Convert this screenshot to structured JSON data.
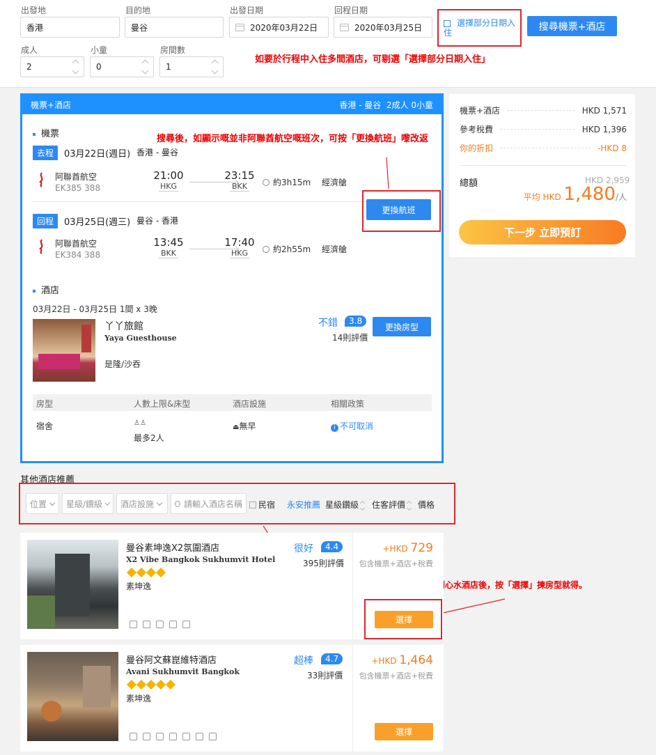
{
  "search": {
    "from_label": "出發地",
    "from_value": "香港",
    "to_label": "目的地",
    "to_value": "曼谷",
    "depart_label": "出發日期",
    "depart_value": "2020年03月22日",
    "return_label": "回程日期",
    "return_value": "2020年03月25日",
    "partial_label": "選擇部分日期入住",
    "search_button": "搜尋機票+酒店",
    "adults_label": "成人",
    "adults_value": "2",
    "children_label": "小童",
    "children_value": "0",
    "rooms_label": "房間數",
    "rooms_value": "1"
  },
  "annotations": {
    "partial_tip": "如要於行程中入住多間酒店，可剔選「選擇部分日期入住」",
    "flight_tip": "搜尋後，如顯示嘅並非阿聯酋航空嘅班次，可按「更換航班」嚟改返",
    "filter_tip": "於「位置」、「星級」及「價格」等作篩選及排序，揾到心水酒店後，按「選擇」揀房型就得。"
  },
  "package": {
    "header_title": "機票+酒店",
    "header_summary": "香港 - 曼谷  2成人 0小童",
    "flights_section": "機票",
    "outbound": {
      "tag": "去程",
      "date": "03月22日(週日)",
      "route": "香港 - 曼谷",
      "airline": "阿聯酋航空",
      "flight_no": "EK385 388",
      "dep_time": "21:00",
      "dep_code": "HKG",
      "arr_time": "23:15",
      "arr_code": "BKK",
      "duration": "約3h15m",
      "cabin": "經濟艙"
    },
    "change_flight_button": "更換航班",
    "inbound": {
      "tag": "回程",
      "date": "03月25日(週三)",
      "route": "曼谷 - 香港",
      "airline": "阿聯酋航空",
      "flight_no": "EK384 388",
      "dep_time": "13:45",
      "dep_code": "BKK",
      "arr_time": "17:40",
      "arr_code": "HKG",
      "duration": "約2h55m",
      "cabin": "經濟艙"
    },
    "hotel_section": "酒店",
    "hotel": {
      "stay": "03月22日 - 03月25日 1間 x 3晚",
      "name": "丫丫旅館",
      "name_en": "Yaya Guesthouse",
      "rating_text": "不錯",
      "score": "3.8",
      "reviews": "14則評價",
      "area": "是隆/沙吞",
      "change_room_button": "更換房型",
      "table_headers": [
        "房型",
        "人數上限&床型",
        "酒店設施",
        "相關政策"
      ],
      "room_type": "宿舍",
      "capacity": "最多2人",
      "facility": "無早",
      "policy": "不可取消"
    }
  },
  "price": {
    "package_label": "機票+酒店",
    "package_value": "HKD 1,571",
    "tax_label": "參考稅費",
    "tax_value": "HKD 1,396",
    "discount_label": "你的折扣",
    "discount_value": "-HKD 8",
    "total_label": "總額",
    "total_value": "HKD 2,959",
    "avg_prefix": "平均 HKD",
    "avg_value": "1,480",
    "avg_suffix": "/人",
    "next_button": "下一步 立即預訂"
  },
  "other_hotels": {
    "title": "其他酒店推薦",
    "filters": {
      "location": "位置",
      "stars": "星級/鑽級",
      "facilities": "酒店設施",
      "search_placeholder": "請輸入酒店名稱",
      "hostel": "民宿",
      "sort_recommended": "永安推薦",
      "sort_stars": "星級鑽級",
      "sort_rating": "住客評價",
      "sort_price": "價格"
    },
    "items": [
      {
        "name": "曼谷素坤逸X2氛圍酒店",
        "name_en": "X2 Vibe Bangkok Sukhumvit Hotel",
        "area": "素坤逸",
        "rating_text": "很好",
        "score": "4.4",
        "reviews": "395則評價",
        "price_prefix": "+HKD",
        "price": "729",
        "price_note": "包含機票+酒店+稅費",
        "select_button": "選擇"
      },
      {
        "name": "曼谷阿文蘇崑維特酒店",
        "name_en": "Avani Sukhumvit Bangkok",
        "area": "素坤逸",
        "rating_text": "超棒",
        "score": "4.7",
        "reviews": "33則評價",
        "price_prefix": "+HKD",
        "price": "1,464",
        "price_note": "包含機票+酒店+稅費",
        "select_button": "選擇"
      }
    ]
  },
  "colors": {
    "accent": "#1e90ff",
    "annotation": "#e00000",
    "orange": "#f77a1c"
  }
}
